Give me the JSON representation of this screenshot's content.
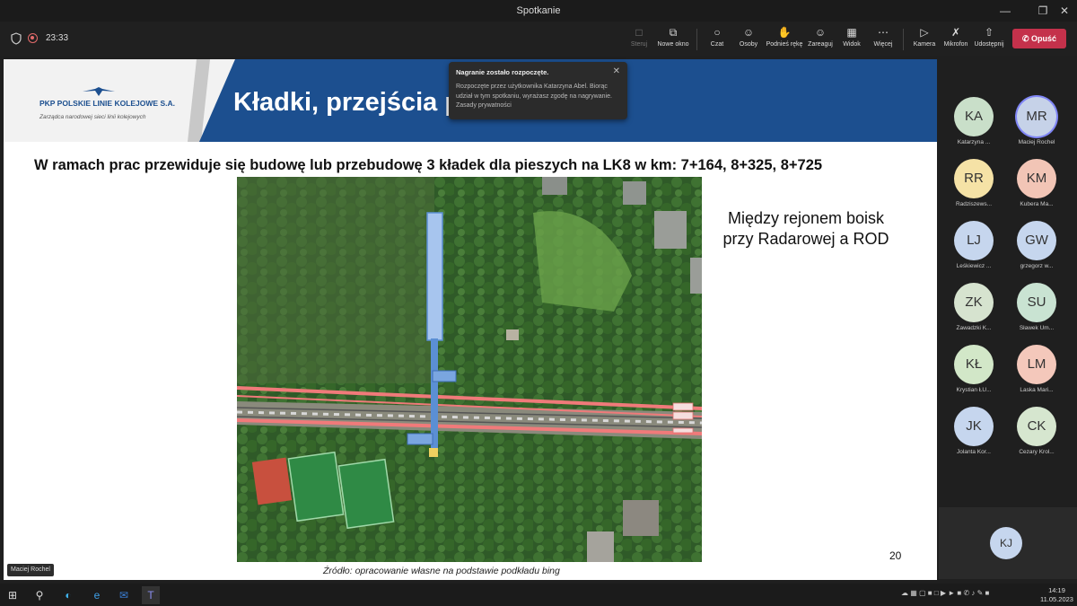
{
  "window": {
    "title": "Spotkanie",
    "minimize_icon": "minimize-icon",
    "restore_icon": "restore-icon",
    "close_icon": "close-icon"
  },
  "meeting": {
    "timer": "23:33",
    "toolbar": [
      {
        "label": "Steruj",
        "icon": "control-icon"
      },
      {
        "label": "Nowe okno",
        "icon": "new-window-icon"
      },
      {
        "label": "Czat",
        "icon": "chat-icon"
      },
      {
        "label": "Osoby",
        "icon": "people-icon"
      },
      {
        "label": "Podnieś rękę",
        "icon": "raise-hand-icon"
      },
      {
        "label": "Zareaguj",
        "icon": "react-icon"
      },
      {
        "label": "Widok",
        "icon": "view-icon"
      },
      {
        "label": "Więcej",
        "icon": "more-icon"
      },
      {
        "label": "Kamera",
        "icon": "camera-icon"
      },
      {
        "label": "Mikrofon",
        "icon": "mic-off-icon"
      },
      {
        "label": "Udostępnij",
        "icon": "share-icon"
      }
    ],
    "leave_label": "Opuść",
    "presenter_chip": "Maciej Rochel"
  },
  "toast": {
    "title": "Nagranie zostało rozpoczęte.",
    "body": "Rozpoczęte przez użytkownika Katarzyna Abel. Biorąc udział w tym spotkaniu, wyrażasz zgodę na nagrywanie. Zasady prywatności"
  },
  "slide": {
    "logo_name": "PKP POLSKIE LINIE KOLEJOWE S.A.",
    "logo_sub": "Zarządca narodowej sieci linii kolejowych",
    "title": "Kładki, przejścia p",
    "title_tail": "i",
    "subtitle": "W ramach prac przewiduje się budowę lub przebudowę 3 kładek dla pieszych na LK8 w km: 7+164, 8+325, 8+725",
    "caption_right": "Między rejonem boisk przy Radarowej a ROD",
    "page_number": "20",
    "source": "Źródło: opracowanie własne na podstawie podkładu bing"
  },
  "participants": [
    {
      "initials": "KA",
      "name": "Katarzyna ...",
      "color": "#c9dfc9"
    },
    {
      "initials": "MR",
      "name": "Maciej Rochel",
      "color": "#c6d2e8",
      "active": true
    },
    {
      "initials": "RR",
      "name": "Radziszews...",
      "color": "#f5e2a6"
    },
    {
      "initials": "KM",
      "name": "Kubera Ma...",
      "color": "#f2c5b6"
    },
    {
      "initials": "LJ",
      "name": "Leśkiewicz ...",
      "color": "#c6d6ee"
    },
    {
      "initials": "GW",
      "name": "grzegorz w...",
      "color": "#c6d6ee"
    },
    {
      "initials": "ZK",
      "name": "Zawadzki K...",
      "color": "#d6e3cf"
    },
    {
      "initials": "SU",
      "name": "Sławek Um...",
      "color": "#c9e3d2"
    },
    {
      "initials": "KŁ",
      "name": "Krystian ŁU...",
      "color": "#d2e7c8"
    },
    {
      "initials": "LM",
      "name": "Laska Mari...",
      "color": "#f4c8bb"
    },
    {
      "initials": "JK",
      "name": "Jolanta Kor...",
      "color": "#c6d6ee"
    },
    {
      "initials": "CK",
      "name": "Cezary Krol...",
      "color": "#d6e6cf"
    }
  ],
  "self_view": {
    "initials": "KJ"
  },
  "taskbar": {
    "time": "14:19",
    "date": "11.05.2023",
    "apps": [
      "windows-icon",
      "search-icon",
      "edge-icon",
      "ie-icon",
      "outlook-icon",
      "teams-icon"
    ]
  }
}
